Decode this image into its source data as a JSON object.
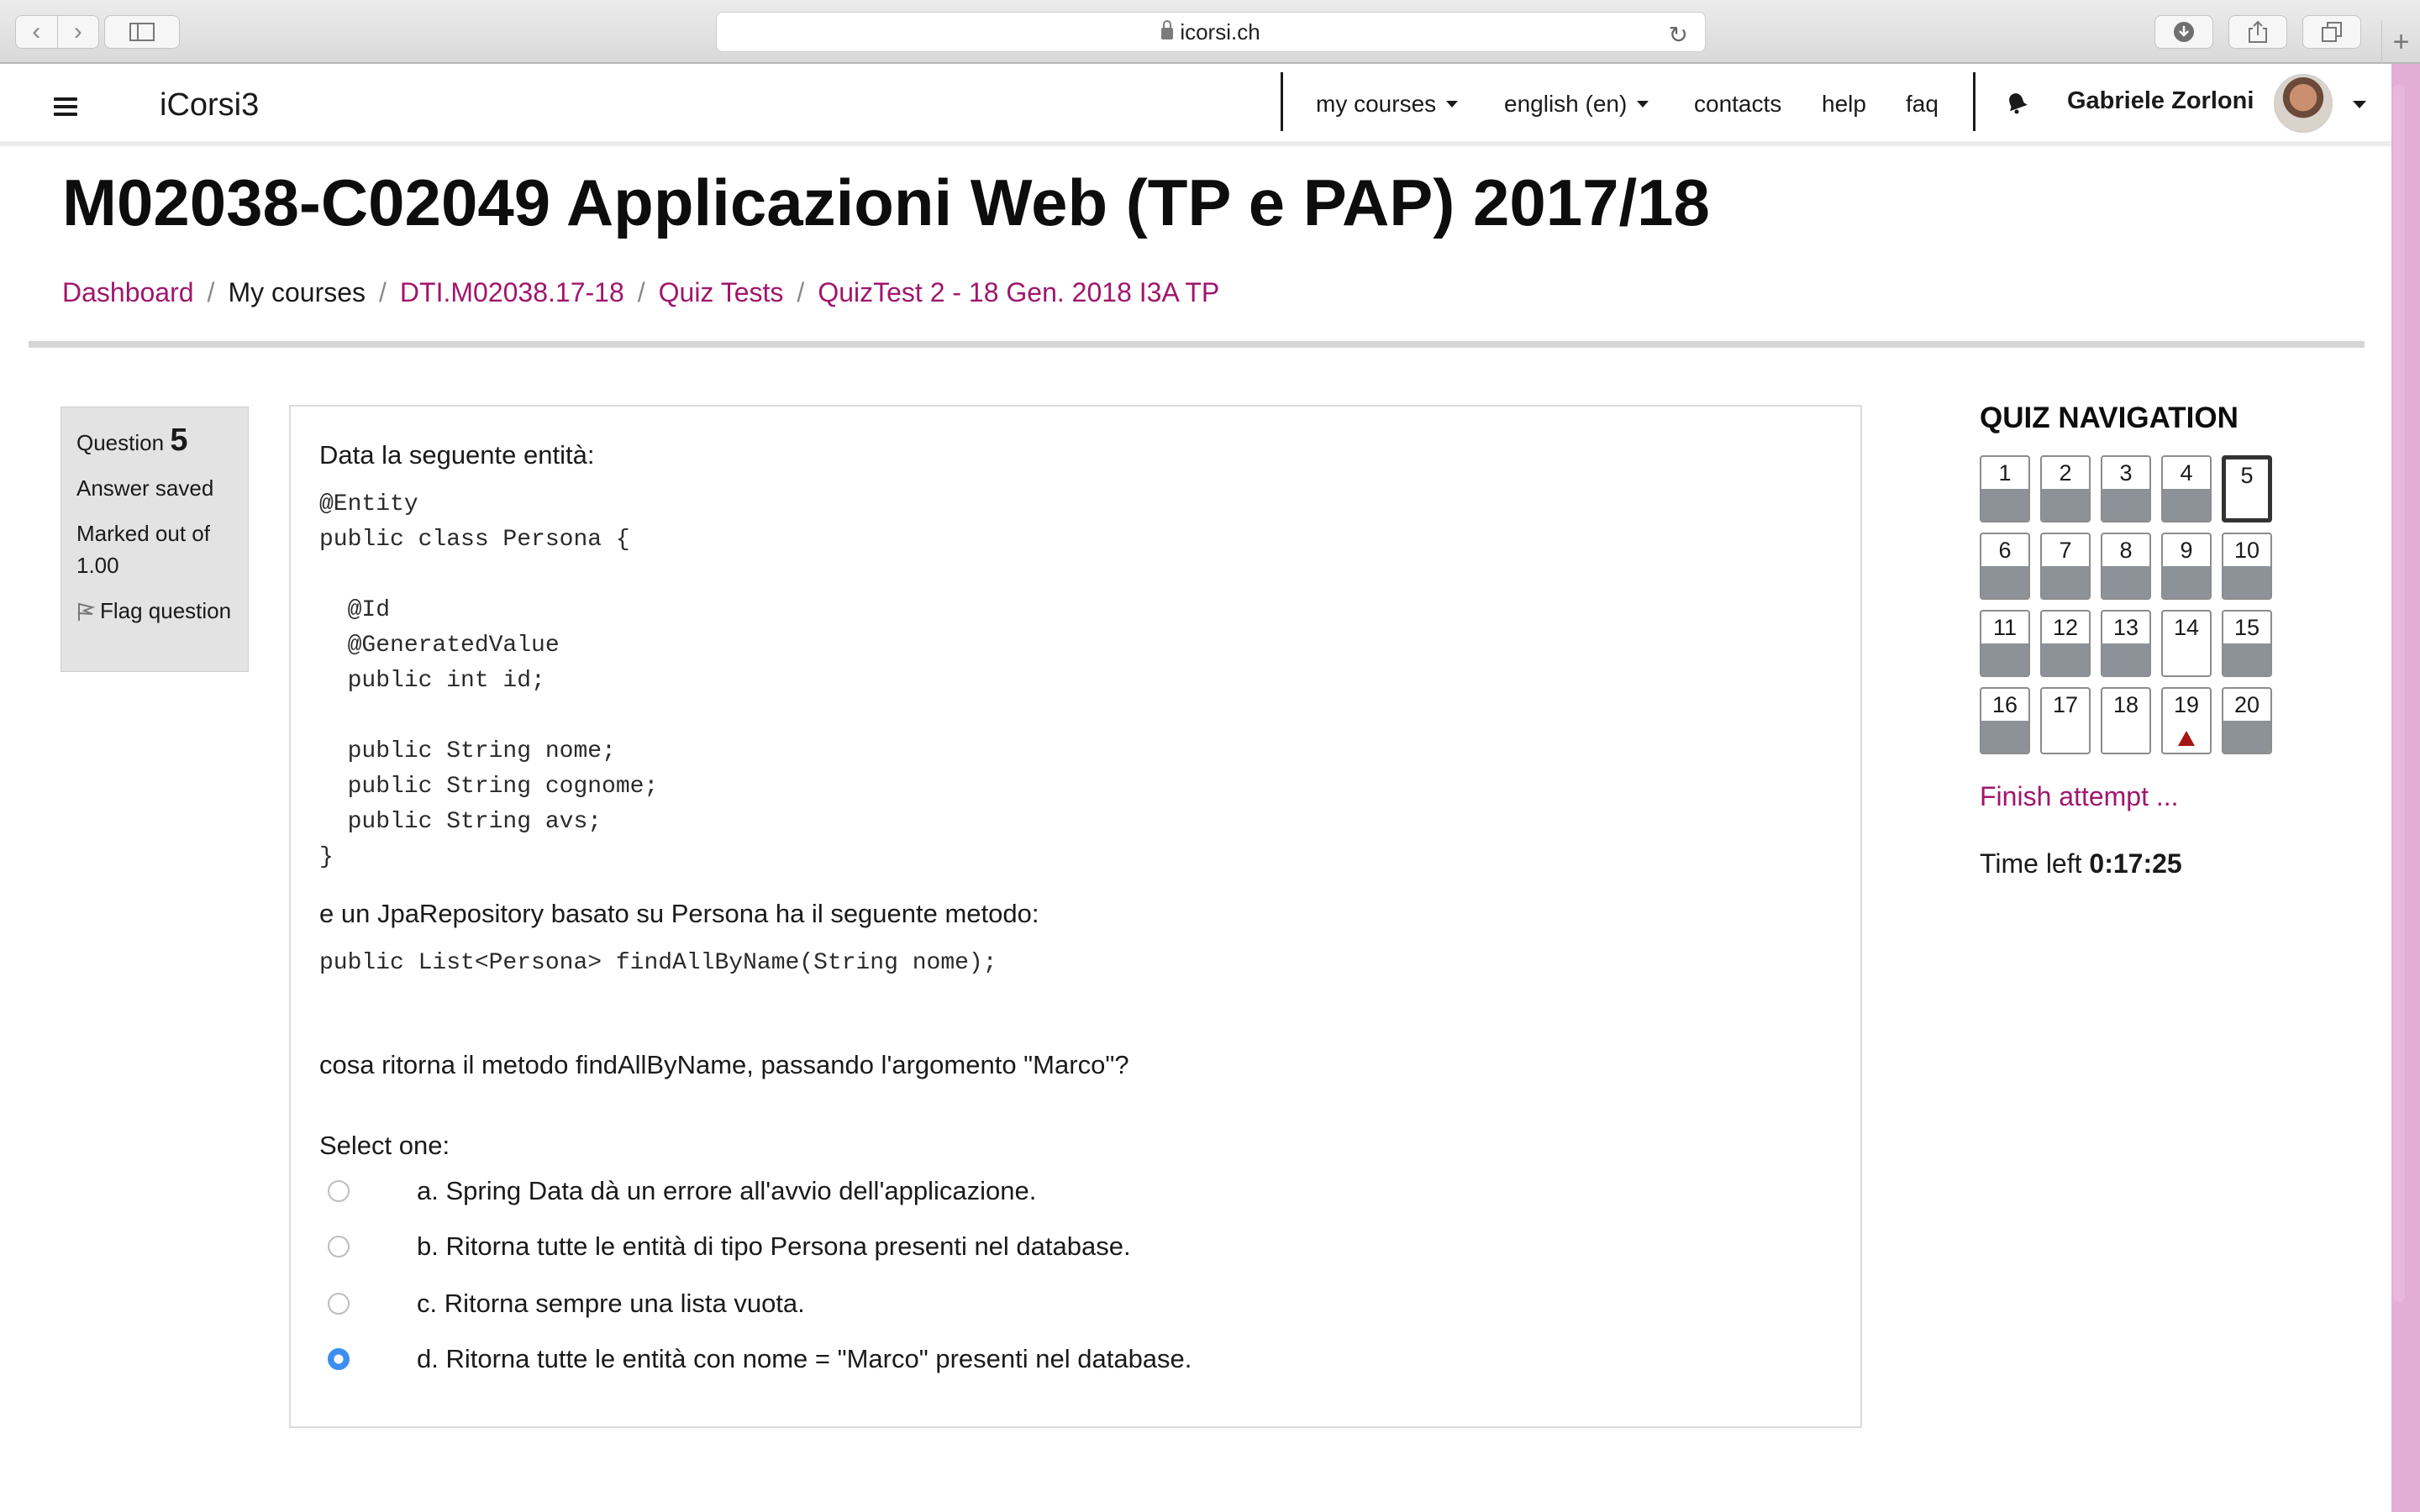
{
  "browser": {
    "url": "icorsi.ch"
  },
  "header": {
    "brand": "iCorsi3",
    "menu": {
      "my_courses": "my courses",
      "language": "english (en)",
      "contacts": "contacts",
      "help": "help",
      "faq": "faq"
    },
    "user_name": "Gabriele Zorloni"
  },
  "page": {
    "title": "M02038-C02049 Applicazioni Web (TP e PAP) 2017/18",
    "breadcrumb": [
      "Dashboard",
      "My courses",
      "DTI.M02038.17-18",
      "Quiz Tests",
      "QuizTest 2 - 18 Gen. 2018 I3A TP"
    ]
  },
  "question_info": {
    "label": "Question",
    "number": "5",
    "state": "Answer saved",
    "marked": "Marked out of 1.00",
    "flag": "Flag question"
  },
  "question": {
    "intro": "Data la seguente entità:",
    "code1": [
      "@Entity",
      "public class Persona {",
      "",
      "  @Id",
      "  @GeneratedValue",
      "  public int id;",
      "",
      "  public String nome;",
      "  public String cognome;",
      "  public String avs;",
      "}"
    ],
    "middle": "e un JpaRepository basato su Persona ha il seguente metodo:",
    "code2": "public List<Persona> findAllByName(String nome);",
    "ask": "cosa ritorna il metodo findAllByName, passando l'argomento \"Marco\"?",
    "select_one": "Select one:",
    "options": [
      "a. Spring Data dà un errore all'avvio dell'applicazione.",
      "b. Ritorna tutte le entità di tipo Persona presenti nel database.",
      "c. Ritorna sempre una lista vuota.",
      "d. Ritorna tutte le entità con nome = \"Marco\" presenti nel database."
    ],
    "selected_option": 3
  },
  "quiz_nav": {
    "title": "QUIZ NAVIGATION",
    "buttons": [
      "1",
      "2",
      "3",
      "4",
      "5",
      "6",
      "7",
      "8",
      "9",
      "10",
      "11",
      "12",
      "13",
      "14",
      "15",
      "16",
      "17",
      "18",
      "19",
      "20"
    ],
    "answered": [
      1,
      2,
      3,
      4,
      6,
      7,
      8,
      9,
      10,
      11,
      12,
      13,
      15,
      16,
      20
    ],
    "current": 5,
    "flagged": [
      19
    ],
    "finish": "Finish attempt ...",
    "time_label": "Time left",
    "time_value": "0:17:25"
  },
  "colors": {
    "link": "#a0166c",
    "answered_fill": "#8d9299",
    "radio_selected": "#3c8ff0",
    "flag": "#a31515"
  }
}
